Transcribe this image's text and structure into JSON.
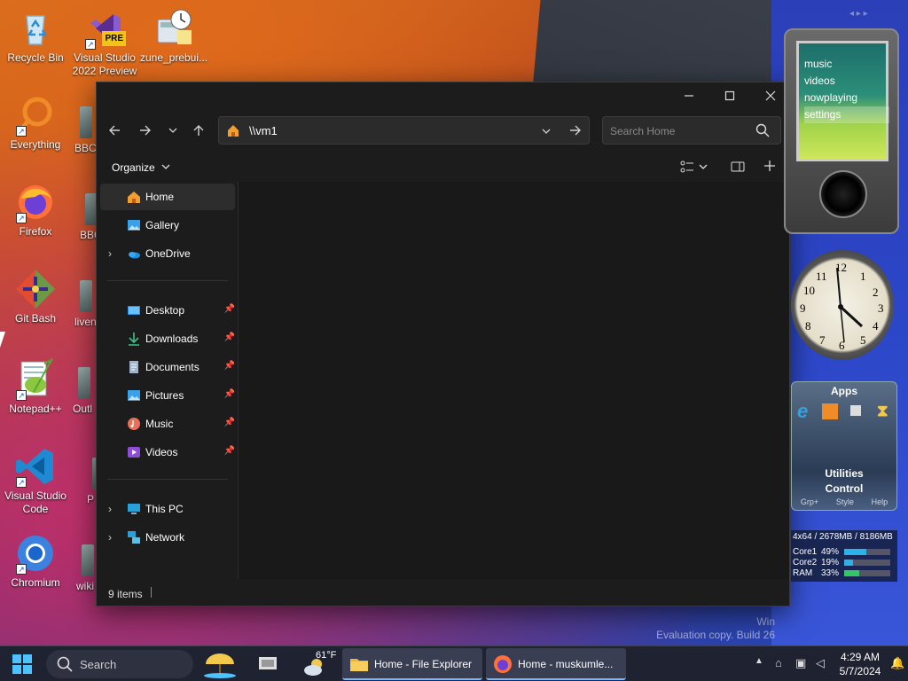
{
  "desktop": {
    "icons": [
      {
        "label": "Recycle Bin"
      },
      {
        "label": "Visual Studio 2022 Preview",
        "line1": "Visual Studio",
        "line2": "2022 Preview",
        "badge": "PRE"
      },
      {
        "label": "zune_prebui..."
      },
      {
        "label": "Everything"
      },
      {
        "label": "Firefox"
      },
      {
        "label": "Git Bash"
      },
      {
        "label": "Notepad++"
      },
      {
        "label": "Visual Studio Code",
        "line1": "Visual Studio",
        "line2": "Code"
      },
      {
        "label": "Chromium"
      }
    ],
    "partial_labels": [
      "BBC",
      "BBC",
      "liven",
      "Outl",
      "P",
      "wiki"
    ],
    "watermark_line1": "Win",
    "watermark_line2": "Evaluation copy. Build 26"
  },
  "explorer": {
    "address": "\\\\vm1",
    "search_placeholder": "Search Home",
    "organize_label": "Organize",
    "nav_items": [
      {
        "label": "Home",
        "icon": "home-icon",
        "selected": true
      },
      {
        "label": "Gallery",
        "icon": "gallery-icon"
      },
      {
        "label": "OneDrive",
        "icon": "onedrive-icon",
        "expandable": true
      },
      {
        "label": "Desktop",
        "icon": "desktop-icon",
        "pinned": true
      },
      {
        "label": "Downloads",
        "icon": "downloads-icon",
        "pinned": true
      },
      {
        "label": "Documents",
        "icon": "documents-icon",
        "pinned": true
      },
      {
        "label": "Pictures",
        "icon": "pictures-icon",
        "pinned": true
      },
      {
        "label": "Music",
        "icon": "music-icon",
        "pinned": true
      },
      {
        "label": "Videos",
        "icon": "videos-icon",
        "pinned": true
      },
      {
        "label": "This PC",
        "icon": "this-pc-icon",
        "expandable": true
      },
      {
        "label": "Network",
        "icon": "network-icon",
        "expandable": true
      }
    ],
    "status": "9 items"
  },
  "gadgets": {
    "zune_menu": [
      "music",
      "videos",
      "nowplaying",
      "settings"
    ],
    "clock_numbers": [
      "12",
      "1",
      "2",
      "3",
      "4",
      "5",
      "6",
      "7",
      "8",
      "9",
      "10",
      "11"
    ],
    "apps_title": "Apps",
    "apps_utilities": "Utilities",
    "apps_control": "Control",
    "apps_footer": [
      "Grp+",
      "Style",
      "Help"
    ],
    "perf_header": "4x64 / 2678MB / 8186MB",
    "perf_rows": [
      {
        "label": "Core1",
        "value": "49%",
        "level": 0.49
      },
      {
        "label": "Core2",
        "value": "19%",
        "level": 0.19
      },
      {
        "label": "RAM",
        "value": "33%",
        "level": 0.33
      }
    ]
  },
  "taskbar": {
    "search_label": "Search",
    "weather": "61°F",
    "apps": [
      {
        "label": "Home - File Explorer"
      },
      {
        "label": "Home - muskumle..."
      }
    ],
    "time": "4:29 AM",
    "date": "5/7/2024"
  },
  "colors": {
    "accent": "#79b7ff",
    "window_bg": "#191919",
    "taskbar_bg": "#1f2230"
  }
}
